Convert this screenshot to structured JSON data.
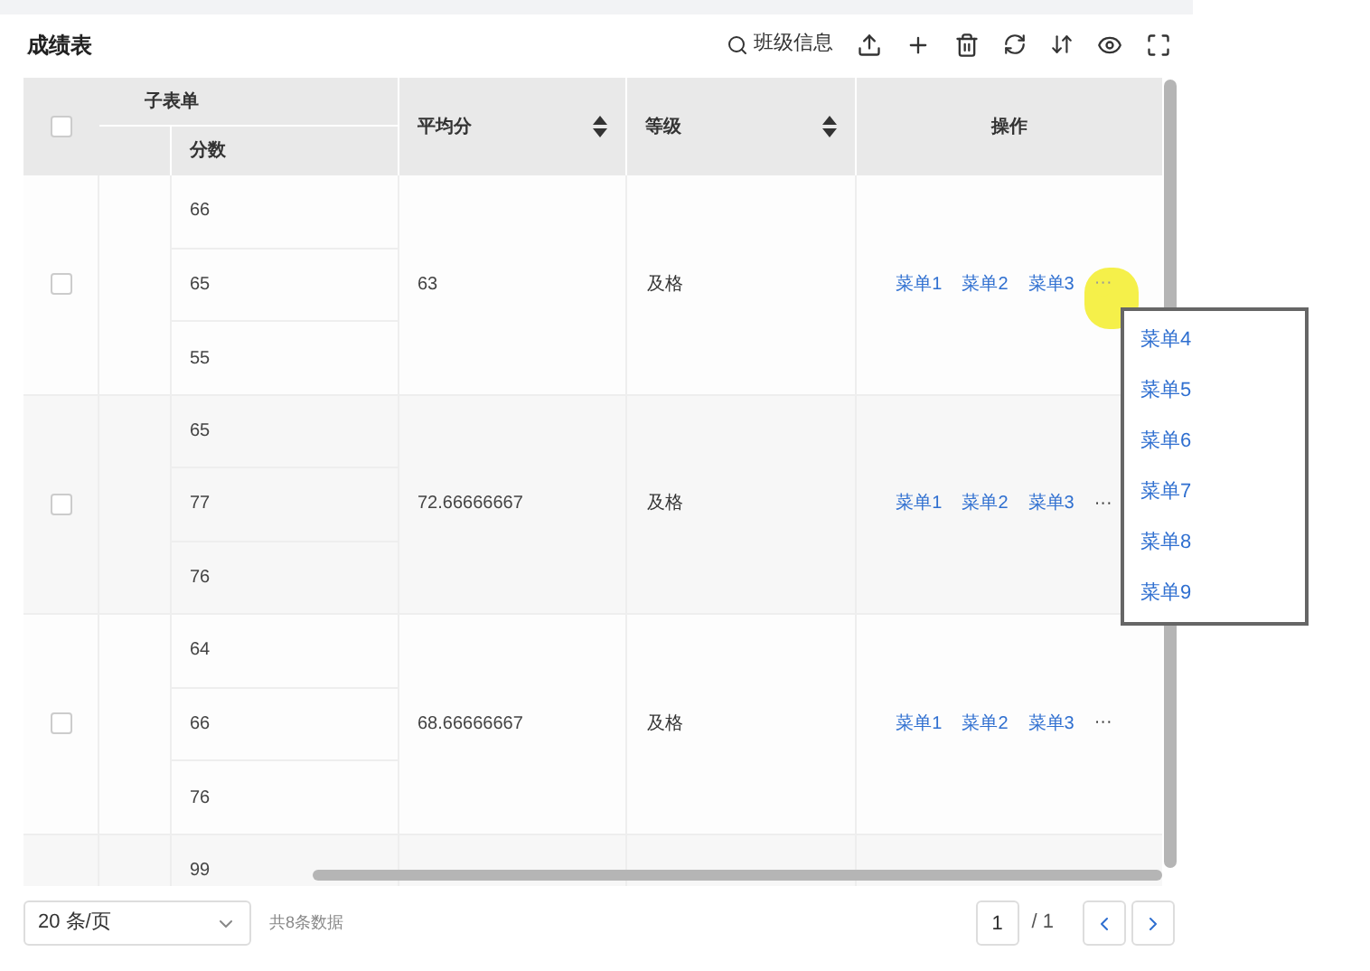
{
  "title": "成绩表",
  "toolbar": {
    "search_label": "班级信息"
  },
  "header": {
    "group": "子表单",
    "sub": "分数",
    "select_all_checked": false
  },
  "columns": [
    {
      "label": "平均分",
      "sortable": true
    },
    {
      "label": "等级",
      "sortable": true
    },
    {
      "label": "操作",
      "sortable": false
    }
  ],
  "rows": [
    {
      "checked": false,
      "scores": [
        "66",
        "65",
        "55"
      ],
      "average": "63",
      "grade": "及格",
      "actions": [
        "菜单1",
        "菜单2",
        "菜单3"
      ],
      "more": "···",
      "menu_open": true
    },
    {
      "checked": false,
      "scores": [
        "65",
        "77",
        "76"
      ],
      "average": "72.66666667",
      "grade": "及格",
      "actions": [
        "菜单1",
        "菜单2",
        "菜单3"
      ],
      "more": "···",
      "menu_open": false
    },
    {
      "checked": false,
      "scores": [
        "64",
        "66",
        "76"
      ],
      "average": "68.66666667",
      "grade": "及格",
      "actions": [
        "菜单1",
        "菜单2",
        "菜单3"
      ],
      "more": "···",
      "menu_open": false
    },
    {
      "scores": [
        "99"
      ]
    }
  ],
  "menu": {
    "items": [
      "菜单4",
      "菜单5",
      "菜单6",
      "菜单7",
      "菜单8",
      "菜单9"
    ]
  },
  "pagination": {
    "page_size": "20 条/页",
    "total": "共8条数据",
    "page": "1",
    "pages": "/ 1"
  }
}
